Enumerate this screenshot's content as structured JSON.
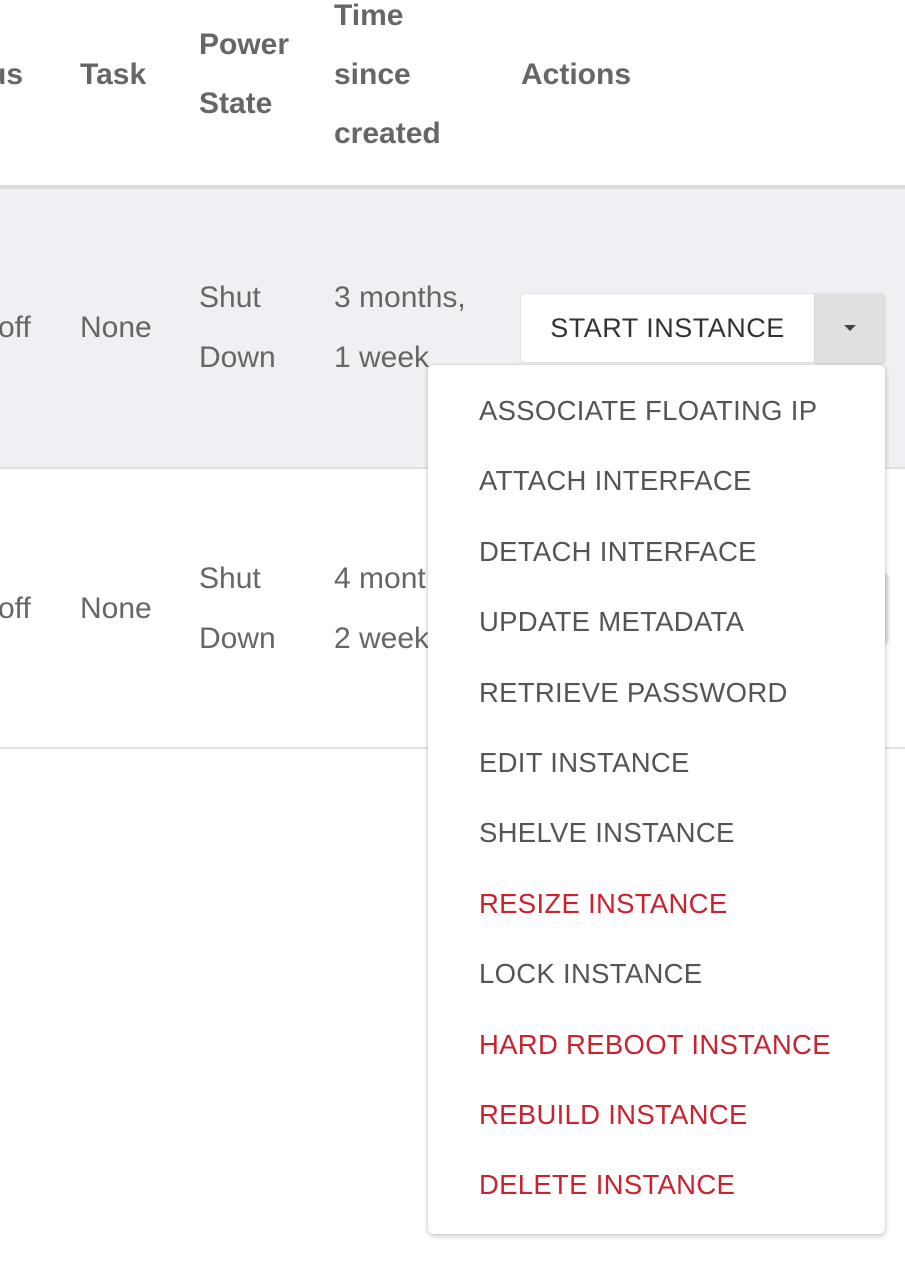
{
  "table": {
    "headers": {
      "status": "us",
      "task": "Task",
      "power_state": [
        "Power",
        "State"
      ],
      "time_since_created": [
        "Time",
        "since",
        "created"
      ],
      "actions": "Actions"
    },
    "rows": [
      {
        "status": "off",
        "task": "None",
        "power_state": [
          "Shut",
          "Down"
        ],
        "time_since_created": [
          "3 months,",
          "1 week"
        ],
        "action_button": "START INSTANCE"
      },
      {
        "status": "off",
        "task": "None",
        "power_state": [
          "Shut",
          "Down"
        ],
        "time_since_created": [
          "4 mont",
          "2 week"
        ]
      }
    ]
  },
  "dropdown": {
    "items": [
      {
        "label": "ASSOCIATE FLOATING IP",
        "danger": false
      },
      {
        "label": "ATTACH INTERFACE",
        "danger": false
      },
      {
        "label": "DETACH INTERFACE",
        "danger": false
      },
      {
        "label": "UPDATE METADATA",
        "danger": false
      },
      {
        "label": "RETRIEVE PASSWORD",
        "danger": false
      },
      {
        "label": "EDIT INSTANCE",
        "danger": false
      },
      {
        "label": "SHELVE INSTANCE",
        "danger": false
      },
      {
        "label": "RESIZE INSTANCE",
        "danger": true
      },
      {
        "label": "LOCK INSTANCE",
        "danger": false
      },
      {
        "label": "HARD REBOOT INSTANCE",
        "danger": true
      },
      {
        "label": "REBUILD INSTANCE",
        "danger": true
      },
      {
        "label": "DELETE INSTANCE",
        "danger": true
      }
    ]
  },
  "colors": {
    "danger": "#c9232f",
    "row_highlight": "#eff0f3",
    "caret_bg": "#e0e0e0"
  }
}
